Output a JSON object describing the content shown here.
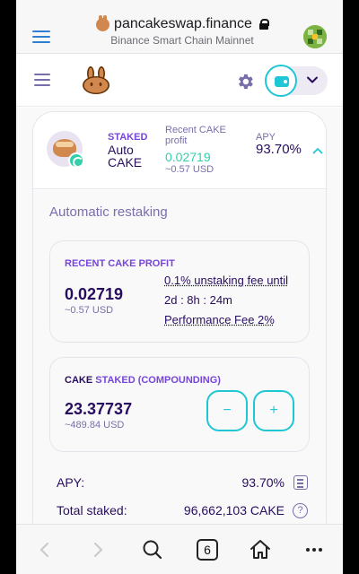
{
  "browser": {
    "domain": "pancakeswap.finance",
    "network": "Binance Smart Chain Mainnet",
    "open_tabs": "6"
  },
  "pool": {
    "tag": "STAKED",
    "name": "Auto CAKE",
    "recent_label": "Recent CAKE profit",
    "recent_value": "0.02719",
    "recent_usd": "~0.57 USD",
    "apy_label": "APY",
    "apy_value": "93.70%"
  },
  "details": {
    "section_title": "Automatic restaking",
    "profit_label": "RECENT CAKE PROFIT",
    "profit_value": "0.02719",
    "profit_usd": "~0.57 USD",
    "fee_line1": "0.1% unstaking fee until",
    "fee_line2": "2d : 8h : 24m",
    "fee_line3": "Performance Fee 2%",
    "staked_label_token": "CAKE",
    "staked_label_rest": " STAKED (COMPOUNDING)",
    "staked_value": "23.37737",
    "staked_usd": "~489.84 USD",
    "minus_label": "−",
    "plus_label": "+",
    "apy_row_label": "APY:",
    "apy_row_value": "93.70%",
    "total_label": "Total staked:",
    "total_value": "96,662,103 CAKE",
    "help_glyph": "?"
  },
  "colors": {
    "primary": "#1fc7d4",
    "secondary": "#7645d9",
    "text": "#280d5f",
    "muted": "#7a6eaa",
    "success": "#31d0aa"
  },
  "icons": [
    "menu-icon",
    "site-favicon-icon",
    "lock-icon",
    "bunny-logo-icon",
    "gear-icon",
    "wallet-icon",
    "chevron-down-icon",
    "cake-token-icon",
    "refresh-icon",
    "chevron-up-icon",
    "calculator-icon",
    "help-icon",
    "back-icon",
    "forward-icon",
    "search-icon",
    "tabs-icon",
    "home-icon",
    "more-icon"
  ]
}
